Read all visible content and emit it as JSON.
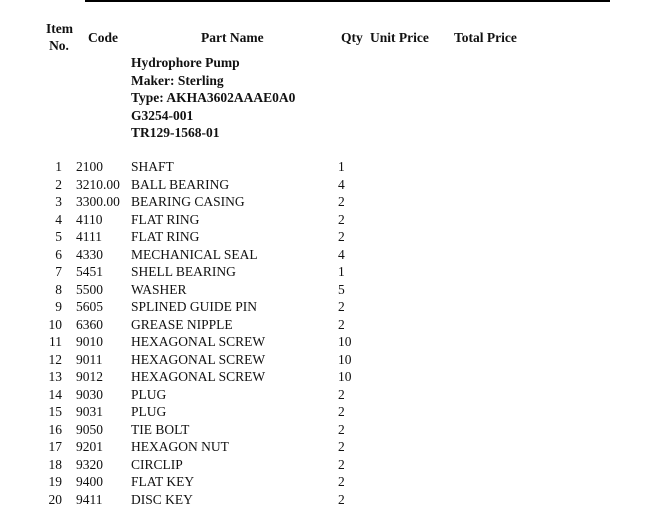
{
  "headers": {
    "item_no": "Item\nNo.",
    "item_line1": "Item",
    "item_line2": "No.",
    "code": "Code",
    "part_name": "Part Name",
    "qty": "Qty",
    "unit_price": "Unit Price",
    "total_price": "Total Price"
  },
  "equipment": {
    "name": "Hydrophore Pump",
    "maker": "Maker: Sterling",
    "type": "Type: AKHA3602AAAE0A0",
    "ref1": "G3254-001",
    "ref2": "TR129-1568-01"
  },
  "parts": [
    {
      "item": "1",
      "code": "2100",
      "name": "SHAFT",
      "qty": "1"
    },
    {
      "item": "2",
      "code": "3210.00",
      "name": "BALL BEARING",
      "qty": "4"
    },
    {
      "item": "3",
      "code": "3300.00",
      "name": "BEARING CASING",
      "qty": "2"
    },
    {
      "item": "4",
      "code": "4110",
      "name": "FLAT RING",
      "qty": "2"
    },
    {
      "item": "5",
      "code": "4111",
      "name": "FLAT RING",
      "qty": "2"
    },
    {
      "item": "6",
      "code": "4330",
      "name": "MECHANICAL SEAL",
      "qty": "4"
    },
    {
      "item": "7",
      "code": "5451",
      "name": "SHELL BEARING",
      "qty": "1"
    },
    {
      "item": "8",
      "code": "5500",
      "name": "WASHER",
      "qty": "5"
    },
    {
      "item": "9",
      "code": "5605",
      "name": "SPLINED GUIDE PIN",
      "qty": "2"
    },
    {
      "item": "10",
      "code": "6360",
      "name": "GREASE NIPPLE",
      "qty": "2"
    },
    {
      "item": "11",
      "code": "9010",
      "name": "HEXAGONAL SCREW",
      "qty": "10"
    },
    {
      "item": "12",
      "code": "9011",
      "name": "HEXAGONAL SCREW",
      "qty": "10"
    },
    {
      "item": "13",
      "code": "9012",
      "name": "HEXAGONAL SCREW",
      "qty": "10"
    },
    {
      "item": "14",
      "code": "9030",
      "name": "PLUG",
      "qty": "2"
    },
    {
      "item": "15",
      "code": "9031",
      "name": "PLUG",
      "qty": "2"
    },
    {
      "item": "16",
      "code": "9050",
      "name": "TIE BOLT",
      "qty": "2"
    },
    {
      "item": "17",
      "code": "9201",
      "name": "HEXAGON NUT",
      "qty": "2"
    },
    {
      "item": "18",
      "code": "9320",
      "name": "CIRCLIP",
      "qty": "2"
    },
    {
      "item": "19",
      "code": "9400",
      "name": "FLAT KEY",
      "qty": "2"
    },
    {
      "item": "20",
      "code": "9411",
      "name": "DISC KEY",
      "qty": "2"
    }
  ]
}
